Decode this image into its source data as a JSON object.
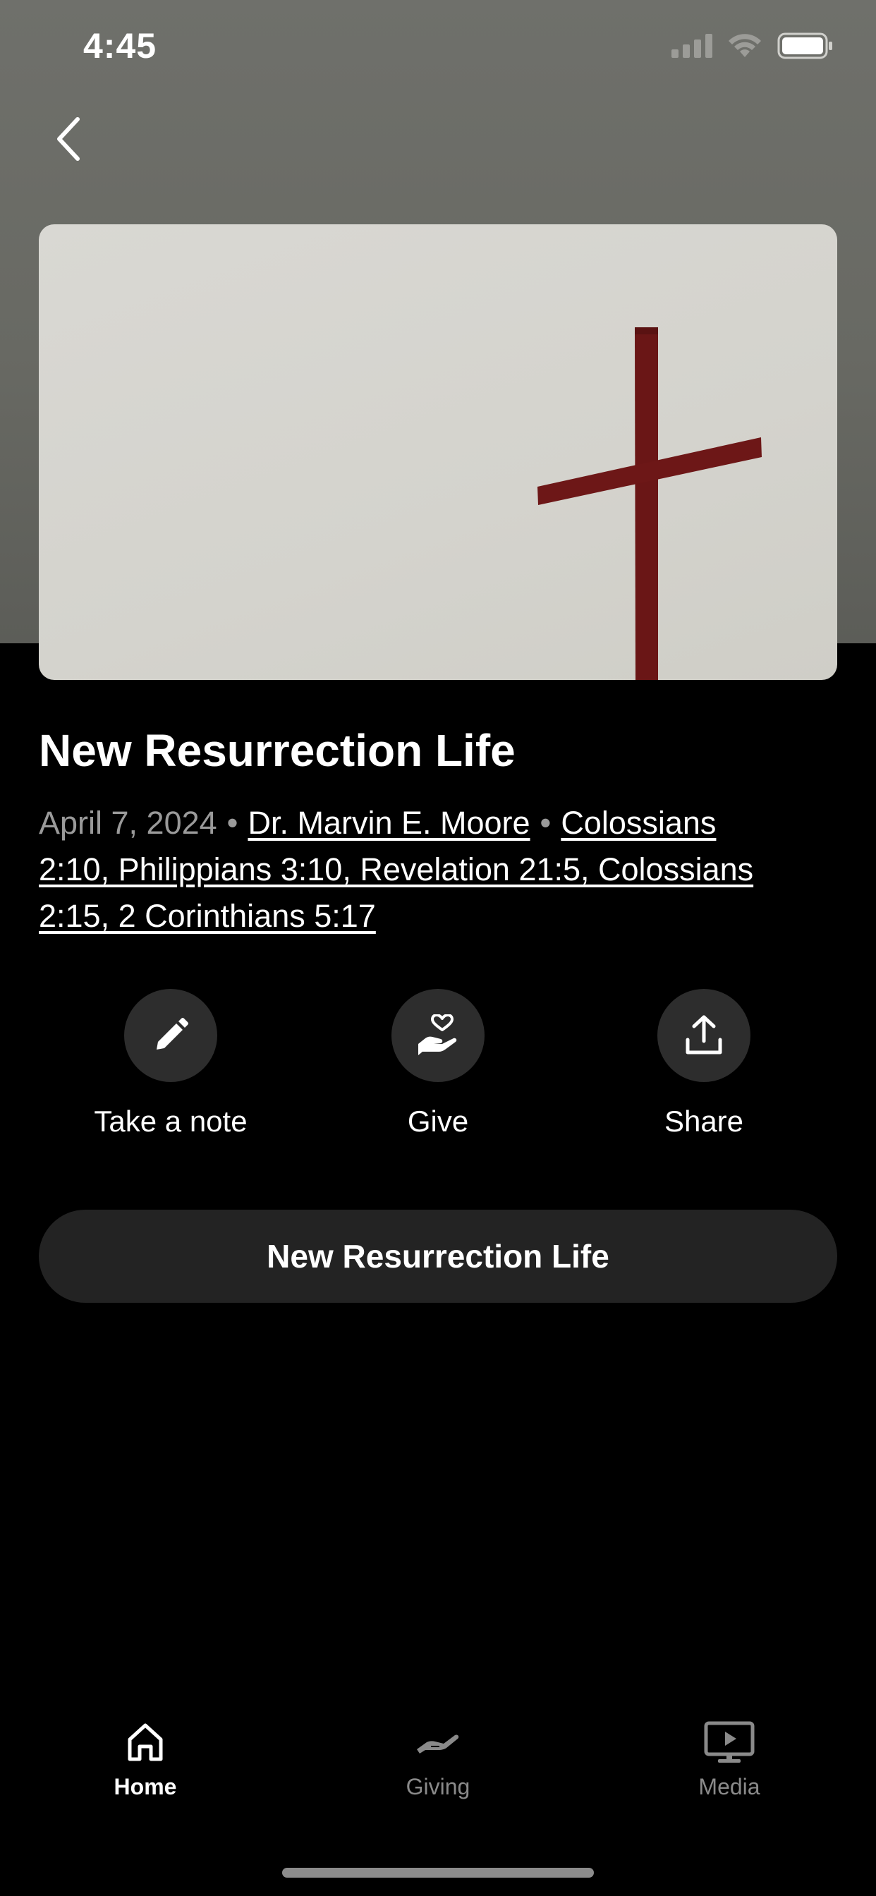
{
  "status_bar": {
    "time": "4:45"
  },
  "sermon": {
    "title": "New Resurrection Life",
    "date": "April 7, 2024",
    "speaker": "Dr. Marvin E. Moore",
    "scripture_line1": "Colossians",
    "scripture_line2": "2:10, Philippians 3:10, Revelation 21:5, Colossians",
    "scripture_line3": "2:15, 2 Corinthians 5:17"
  },
  "actions": [
    {
      "label": "Take a note",
      "icon": "pencil-icon"
    },
    {
      "label": "Give",
      "icon": "hand-heart-icon"
    },
    {
      "label": "Share",
      "icon": "share-icon"
    }
  ],
  "media_button": {
    "label": "New Resurrection Life"
  },
  "tabs": [
    {
      "label": "Home",
      "icon": "home-icon",
      "active": true
    },
    {
      "label": "Giving",
      "icon": "giving-hand-icon",
      "active": false
    },
    {
      "label": "Media",
      "icon": "media-play-icon",
      "active": false
    }
  ],
  "colors": {
    "background": "#000000",
    "header_band": "#6b6c67",
    "action_circle": "#2d2d2d",
    "button_bg": "#232323",
    "cross": "#6a1616"
  }
}
